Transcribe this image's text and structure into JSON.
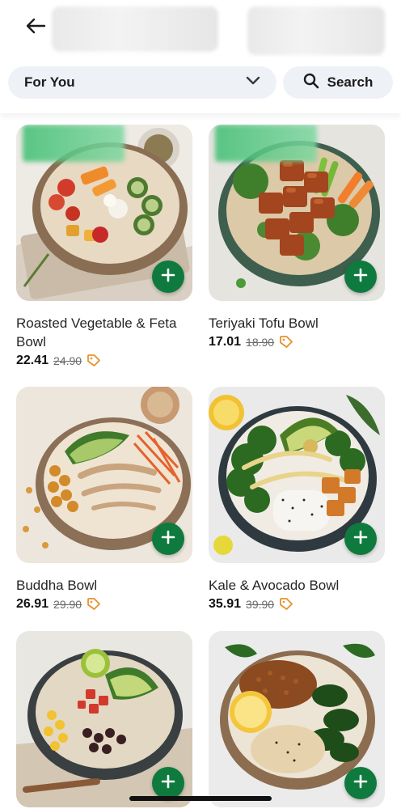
{
  "header": {
    "back_icon": "arrow-left-icon"
  },
  "filters": {
    "category_selected": "For You",
    "dropdown_icon": "chevron-down-icon",
    "search_label": "Search",
    "search_icon": "search-icon"
  },
  "products": [
    {
      "name": "Roasted Vegetable & Feta Bowl",
      "price": "22.41",
      "old_price": "24.90"
    },
    {
      "name": "Teriyaki Tofu Bowl",
      "price": "17.01",
      "old_price": "18.90"
    },
    {
      "name": "Buddha Bowl",
      "price": "26.91",
      "old_price": "29.90"
    },
    {
      "name": "Kale & Avocado Bowl",
      "price": "35.91",
      "old_price": "39.90"
    }
  ],
  "colors": {
    "accent": "#0f7a3e",
    "sale_tag": "#e8912b",
    "pill_bg": "#eef1f6"
  }
}
